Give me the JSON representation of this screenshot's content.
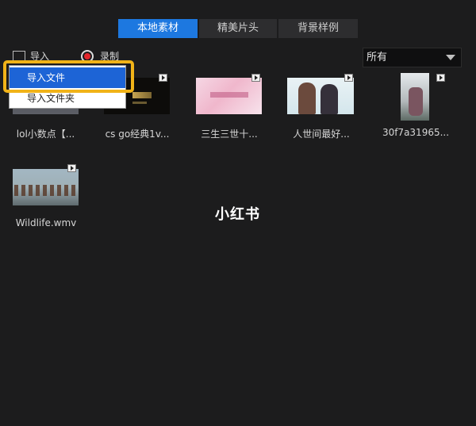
{
  "tabs": [
    {
      "label": "本地素材",
      "active": true
    },
    {
      "label": "精美片头",
      "active": false
    },
    {
      "label": "背景样例",
      "active": false
    }
  ],
  "toolbar": {
    "import_label": "导入",
    "record_label": "录制"
  },
  "filter": {
    "selected": "所有"
  },
  "context_menu": {
    "items": [
      {
        "label": "导入文件",
        "selected": true
      },
      {
        "label": "导入文件夹",
        "selected": false
      }
    ]
  },
  "media": [
    {
      "name": "lol小数点【..."
    },
    {
      "name": "cs go经典1v..."
    },
    {
      "name": "三生三世十..."
    },
    {
      "name": "人世间最好..."
    },
    {
      "name": "30f7a31965..."
    },
    {
      "name": "Wildlife.wmv"
    }
  ],
  "watermark": "小红书",
  "colors": {
    "accent": "#1d78e0",
    "highlight": "#f1b318",
    "background": "#1c1c1d",
    "record": "#e4252b"
  }
}
